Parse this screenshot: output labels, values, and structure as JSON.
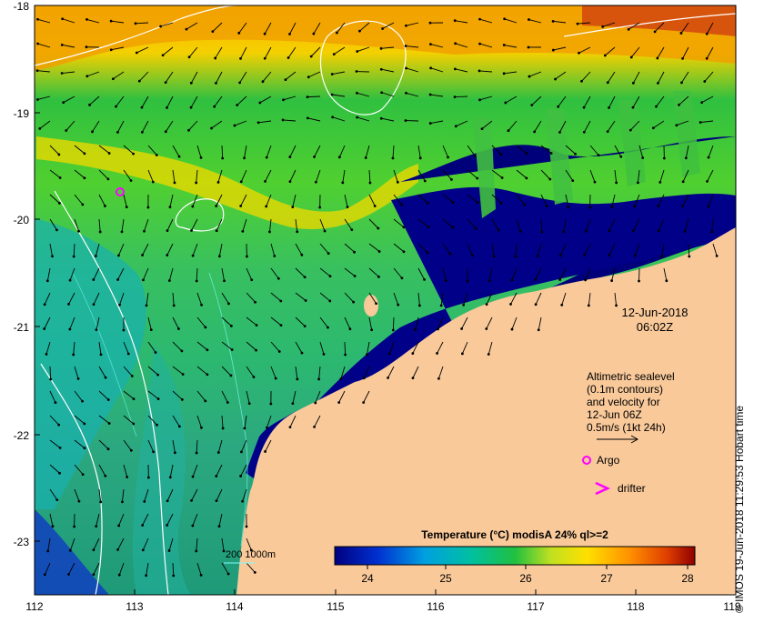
{
  "map": {
    "lat_ticks": [
      "-18",
      "-19",
      "-20",
      "-21",
      "-22",
      "-23"
    ],
    "lon_ticks": [
      "112",
      "113",
      "114",
      "115",
      "116",
      "117",
      "118",
      "119"
    ],
    "date": "12-Jun-2018",
    "time": "06:02Z",
    "altimetry_text": [
      "Altimetric sealevel",
      "(0.1m contours)",
      "and velocity for",
      "12-Jun 06Z",
      "0.5m/s (1kt 24h)"
    ],
    "argo_label": "Argo",
    "drifter_label": "drifter",
    "depth_label": "200  1000m",
    "colorbar": {
      "title": "Temperature (°C) modisA 24% ql>=2",
      "ticks": [
        "24",
        "25",
        "26",
        "27",
        "28"
      ]
    },
    "credit": "© IMOS 19-Jun-2018 11:29:53 Hobart time",
    "colors": {
      "land": "#f9c99a",
      "cold_water": "#00007a",
      "argo": "#ff00ff"
    }
  }
}
